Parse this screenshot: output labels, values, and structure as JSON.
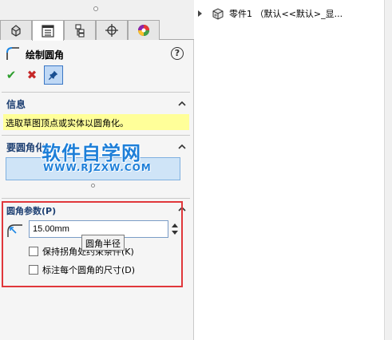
{
  "property_manager": {
    "title": "绘制圆角",
    "help_icon": "?",
    "actions": {
      "ok_icon": "✔",
      "cancel_icon": "✖",
      "pin_icon": "pin-icon"
    },
    "tabs": [
      {
        "icon": "feature-manager-icon"
      },
      {
        "icon": "property-manager-icon"
      },
      {
        "icon": "configuration-manager-icon"
      },
      {
        "icon": "dimxpert-manager-icon"
      },
      {
        "icon": "display-manager-icon"
      }
    ],
    "info_group": {
      "title": "信息",
      "message": "选取草图顶点或实体以圆角化。"
    },
    "entities_group": {
      "title": "要圆角化"
    },
    "params_group": {
      "title": "圆角参数(P)",
      "radius_value": "15.00mm",
      "radius_tooltip": "圆角半径",
      "checkbox_keep_corner": "保持拐角处约束条件(K)",
      "checkbox_dimension_each": "标注每个圆角的尺寸(D)"
    }
  },
  "watermark": {
    "text": "软件自学网",
    "url": "WWW.RJZXW.COM"
  },
  "feature_tree": {
    "root_label": "零件1 （默认<<默认>_显..."
  },
  "colors": {
    "info_background": "#ffff99",
    "selection_background": "#cfe4f7",
    "group_title": "#1d3f72",
    "highlight_frame": "#e0373b",
    "watermark": "#1e7fd8"
  }
}
